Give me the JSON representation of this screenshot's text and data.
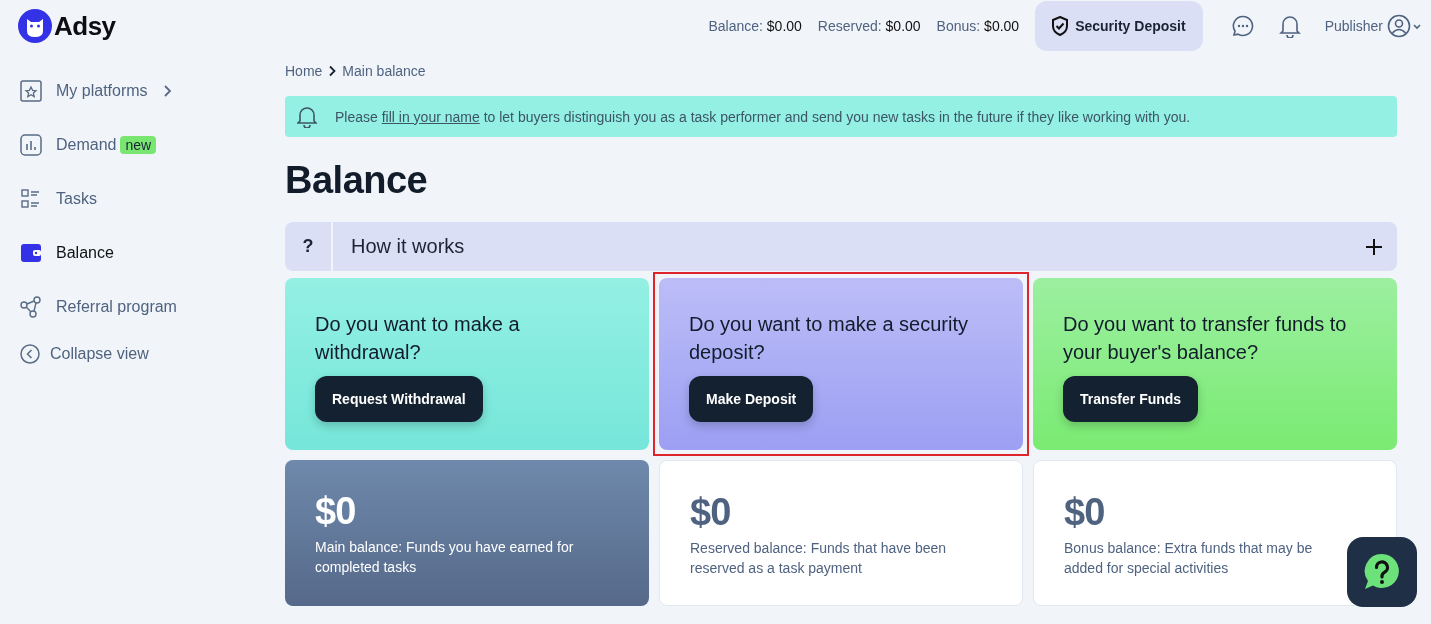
{
  "brand": {
    "name": "Adsy"
  },
  "topbar": {
    "stats": [
      {
        "label": "Balance:",
        "value": "$0.00"
      },
      {
        "label": "Reserved:",
        "value": "$0.00"
      },
      {
        "label": "Bonus:",
        "value": "$0.00"
      }
    ],
    "deposit_button": "Security Deposit",
    "user": "Publisher"
  },
  "sidebar": {
    "items": [
      {
        "kind": "platforms",
        "label": "My platforms",
        "selected": false,
        "has_submenu": true
      },
      {
        "kind": "demand",
        "label": "Demand",
        "badge": "new",
        "selected": false,
        "has_submenu": false
      },
      {
        "kind": "tasks",
        "label": "Tasks",
        "selected": false,
        "has_submenu": false
      },
      {
        "kind": "wallet",
        "label": "Balance",
        "selected": true,
        "has_submenu": false
      },
      {
        "kind": "referral",
        "label": "Referral program",
        "selected": false,
        "has_submenu": false
      }
    ],
    "collapse": "Collapse view"
  },
  "breadcrumb": [
    "Home",
    "Main balance"
  ],
  "notice": {
    "before": "Please ",
    "link": "fill in your name",
    "after": " to let buyers distinguish you as a task performer and send you new tasks in the future if they like working with you."
  },
  "title": "Balance",
  "accordion": {
    "icon": "?",
    "label": "How it works",
    "expanded": false
  },
  "action_cards": [
    {
      "kind": "withdraw",
      "question": "Do you want to make a withdrawal?",
      "button": "Request Withdrawal",
      "highlighted": false
    },
    {
      "kind": "deposit",
      "question": "Do you want to make a security deposit?",
      "button": "Make Deposit",
      "highlighted": true
    },
    {
      "kind": "transfer",
      "question": "Do you want to transfer funds to your buyer's balance?",
      "button": "Transfer Funds",
      "highlighted": false
    }
  ],
  "balance_cards": [
    {
      "amount": "$0",
      "description": "Main balance: Funds you have earned for completed tasks",
      "emphasized": true
    },
    {
      "amount": "$0",
      "description": "Reserved balance: Funds that have been reserved as a task payment",
      "emphasized": false
    },
    {
      "amount": "$0",
      "description": "Bonus balance: Extra funds that may be added for special activities",
      "emphasized": false
    }
  ]
}
